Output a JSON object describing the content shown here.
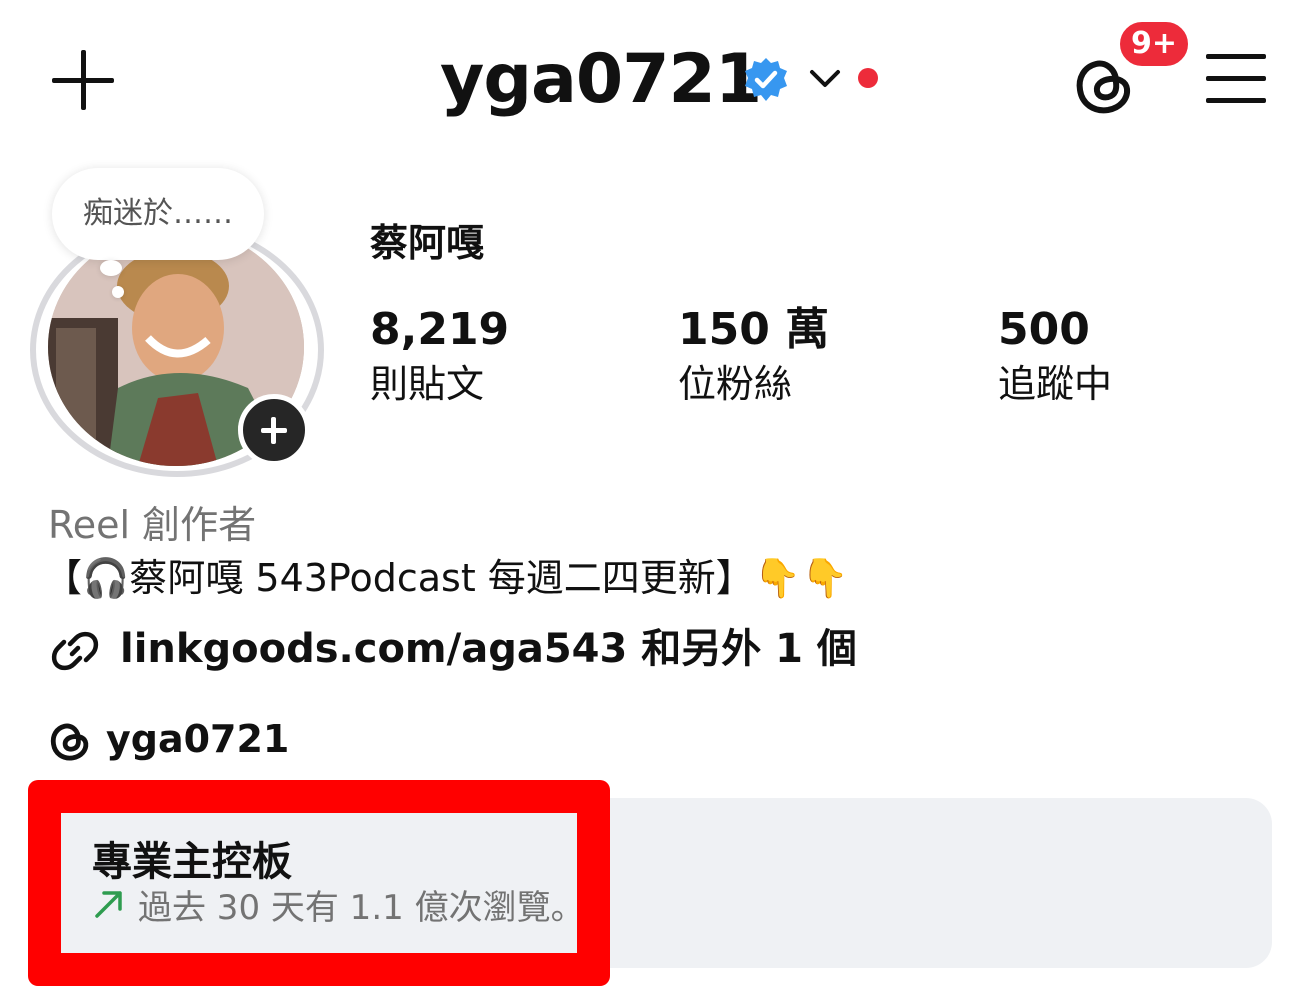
{
  "header": {
    "username": "yga0721",
    "notification_badge": "9+"
  },
  "profile": {
    "note": "痴迷於……",
    "display_name": "蔡阿嘎",
    "stats": [
      {
        "value": "8,219",
        "label": "則貼文"
      },
      {
        "value": "150 萬",
        "label": "位粉絲"
      },
      {
        "value": "500",
        "label": "追蹤中"
      }
    ],
    "category": "Reel 創作者",
    "bio": "【🎧蔡阿嘎 543Podcast 每週二四更新】👇👇",
    "link": "linkgoods.com/aga543 和另外 1 個",
    "threads_handle": "yga0721"
  },
  "dashboard": {
    "title": "專業主控板",
    "subtitle": "過去 30 天有 1.1 億次瀏覽。"
  },
  "colors": {
    "badge_red": "#ed2b3a",
    "verified_blue": "#3797f0",
    "highlight_red": "#ff0000",
    "trend_green": "#2e9c4f",
    "dashboard_bg": "#eff1f4"
  },
  "icons": [
    "plus-icon",
    "verified-badge-icon",
    "chevron-down-icon",
    "threads-icon",
    "hamburger-menu-icon",
    "add-story-icon",
    "link-icon",
    "trend-up-icon"
  ]
}
